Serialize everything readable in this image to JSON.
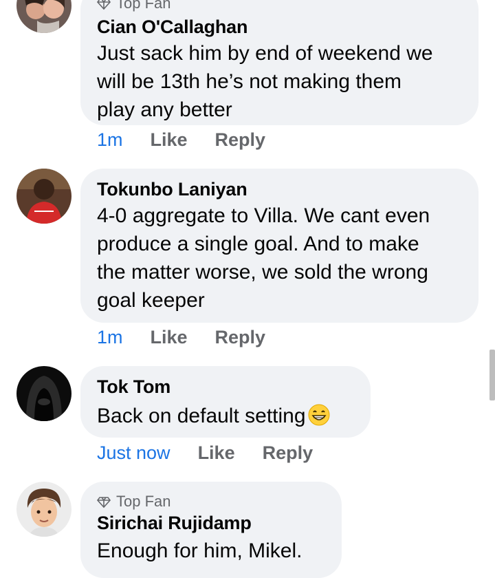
{
  "comments": [
    {
      "badge": "Top Fan",
      "author": "Cian O'Callaghan",
      "lines": [
        "Just sack him by end of weekend we",
        "will be 13th he’s not making them",
        "play any better"
      ],
      "time": "1m",
      "like": "Like",
      "reply": "Reply"
    },
    {
      "author": "Tokunbo Laniyan",
      "lines": [
        "4-0 aggregate to Villa. We cant even",
        "produce a single goal. And to make",
        "the matter worse, we sold  the wrong",
        "goal keeper"
      ],
      "time": "1m",
      "like": "Like",
      "reply": "Reply"
    },
    {
      "author": "Tok Tom",
      "text": "Back on default setting",
      "emoji": "grinning-face-icon",
      "time": "Just now",
      "like": "Like",
      "reply": "Reply"
    },
    {
      "badge": "Top Fan",
      "author": "Sirichai Rujidamp",
      "text": "Enough for him, Mikel."
    }
  ],
  "colors": {
    "bubble": "#f0f2f5",
    "link": "#1b74e4",
    "secondary": "#65676b"
  }
}
